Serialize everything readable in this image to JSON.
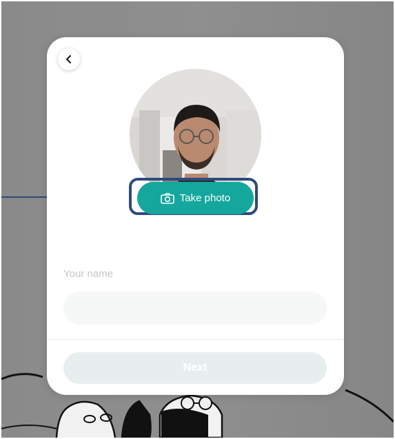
{
  "card": {
    "back_icon": "chevron-left-icon",
    "take_photo_label": "Take photo",
    "camera_icon": "camera-icon",
    "name_label": "Your name",
    "name_value": "",
    "next_label": "Next"
  },
  "colors": {
    "accent": "#15a79d",
    "highlight_frame": "#2e4a7d",
    "next_disabled": "#e8eeee"
  }
}
